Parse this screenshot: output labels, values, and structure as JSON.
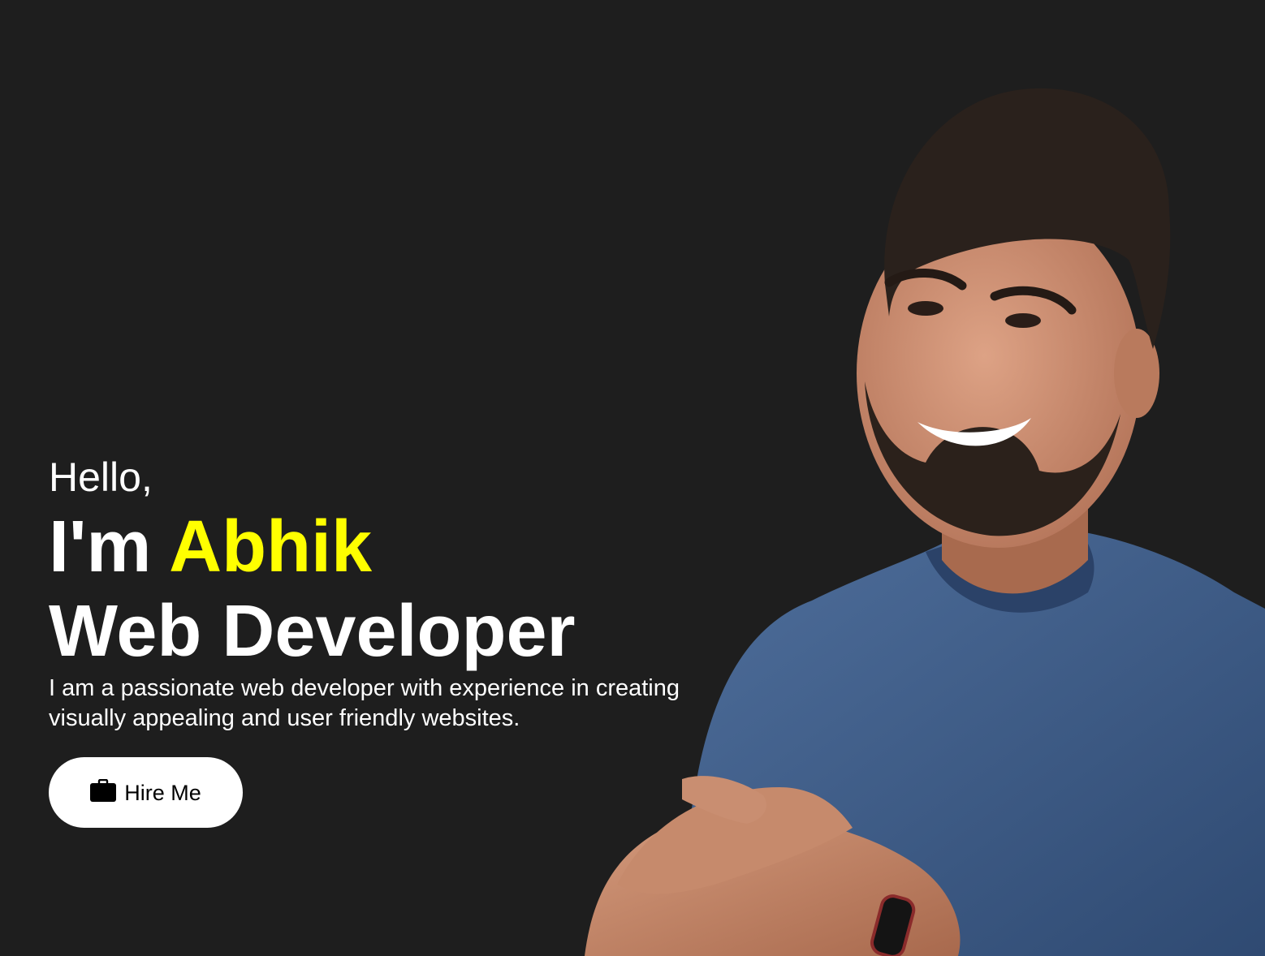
{
  "hero": {
    "greeting": "Hello,",
    "name_prefix": "I'm ",
    "name": "Abhik",
    "role": "Web Developer",
    "bio": "I am a passionate web developer with experience in creating visually appealing and user friendly websites.",
    "hire_button": {
      "label": "Hire Me",
      "icon": "briefcase-icon"
    },
    "portrait_alt": "Smiling man with beard wearing a blue t-shirt with arms crossed"
  },
  "colors": {
    "background": "#1e1e1e",
    "text": "#ffffff",
    "accent": "#ffff00",
    "button_bg": "#ffffff",
    "button_text": "#000000"
  }
}
